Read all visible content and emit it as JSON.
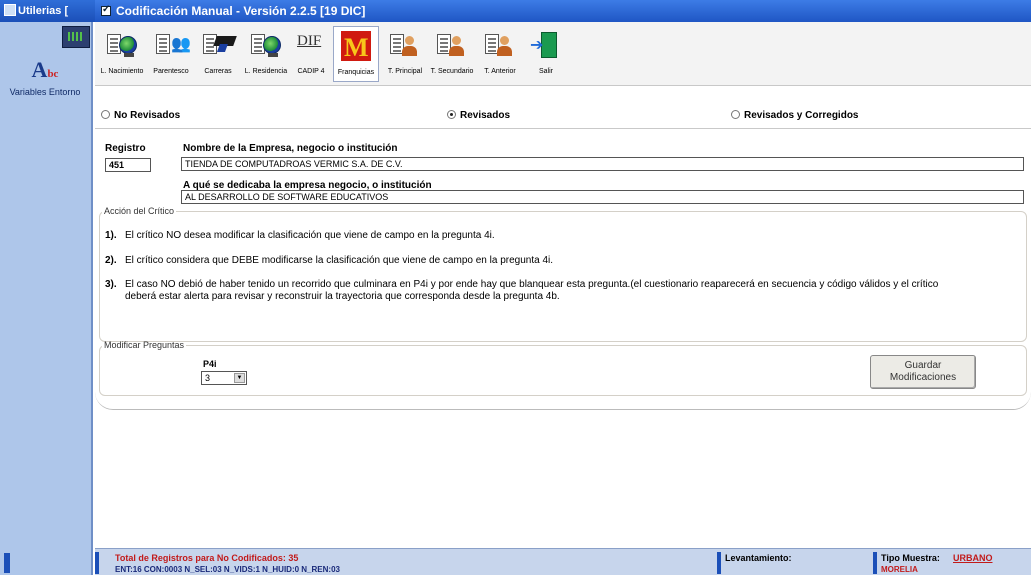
{
  "outer_window": {
    "title": "Utilerias ["
  },
  "left_panel": {
    "item_label": "Variables Entorno"
  },
  "window": {
    "title": "Codificación Manual - Versión 2.2.5 [19 DIC]"
  },
  "toolbar": [
    {
      "label": "L. Nacimiento",
      "icon": "document-globe-icon"
    },
    {
      "label": "Parentesco",
      "icon": "document-people-icon"
    },
    {
      "label": "Carreras",
      "icon": "document-graduation-cap-icon"
    },
    {
      "label": "L. Residencia",
      "icon": "document-globe-icon"
    },
    {
      "label": "CADIP 4",
      "icon": "dif-icon"
    },
    {
      "label": "Franquicias",
      "icon": "mcdonalds-logo-icon"
    },
    {
      "label": "T. Principal",
      "icon": "document-person-icon"
    },
    {
      "label": "T. Secundario",
      "icon": "document-person-icon"
    },
    {
      "label": "T. Anterior",
      "icon": "document-person-icon"
    },
    {
      "label": "Salir",
      "icon": "exit-door-icon"
    }
  ],
  "filters": {
    "no_revisados": "No Revisados",
    "revisados": "Revisados",
    "revisados_corregidos": "Revisados y Corregidos",
    "selected": "Revisados"
  },
  "record": {
    "registro_label": "Registro",
    "registro_value": "451",
    "empresa_label": "Nombre de la Empresa, negocio o institución",
    "empresa_value": "TIENDA DE COMPUTADROAS VERMIC S.A. DE C.V.",
    "actividad_label": "A qué se dedicaba la empresa negocio, o institución",
    "actividad_value": "AL DESARROLLO DE SOFTWARE EDUCATIVOS"
  },
  "accion": {
    "legend": "Acción del Crítico",
    "options": [
      {
        "num": "1).",
        "text": "El crítico NO desea modificar la clasificación que viene de campo en la pregunta 4i."
      },
      {
        "num": "2).",
        "text": "El crítico considera que DEBE modificarse la clasificación que viene de campo en la pregunta 4i."
      },
      {
        "num": "3).",
        "text": "El caso NO debió de haber tenido un recorrido que culminara en P4i y por ende hay que blanquear esta pregunta.(el cuestionario reaparecerá en secuencia y código válidos y el crítico deberá estar alerta para revisar y reconstruir la trayectoria que corresponda desde la pregunta 4b."
      }
    ]
  },
  "modificar": {
    "legend": "Modificar Preguntas",
    "field_label": "P4i",
    "field_value": "3",
    "save_label": "Guardar Modificaciones"
  },
  "status": {
    "total": "Total de Registros para No Codificados: 35",
    "counts": "ENT:16  CON:0003  N_SEL:03  N_VIDS:1  N_HUID:0  N_REN:03",
    "levantamiento": "Levantamiento:",
    "tipo_label": "Tipo Muestra:",
    "tipo_value": "URBANO",
    "ciudad": "MORELIA"
  },
  "colors": {
    "titlebar": "#1f56c4",
    "left_panel": "#aec6ea",
    "status_bar": "#c7d5ec",
    "accent_red": "#c21a1a"
  }
}
